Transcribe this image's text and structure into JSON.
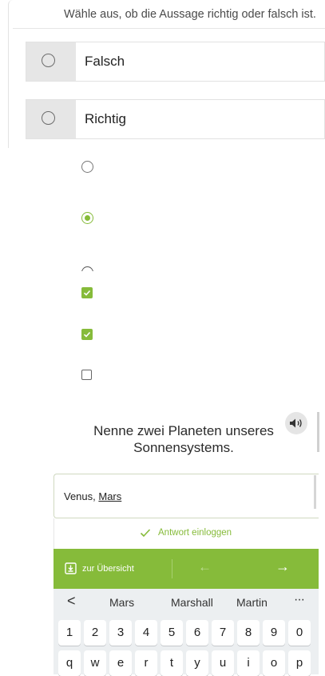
{
  "instruction": "Wähle aus, ob die Aussage richtig oder falsch ist.",
  "options": [
    {
      "label": "Falsch",
      "selected": false
    },
    {
      "label": "Richtig",
      "selected": false
    }
  ],
  "icon_legend": [
    "radio-empty",
    "radio-checked",
    "radio-partial",
    "checkbox-checked",
    "checkbox-checked",
    "checkbox-empty"
  ],
  "question": {
    "text": "Nenne zwei Planeten unseres Sonnensystems.",
    "speaker_icon": "speaker-icon"
  },
  "answer_input": {
    "value_prefix": "Venus, ",
    "value_word": "Mars"
  },
  "submit": {
    "label": "Antwort einloggen"
  },
  "navbar": {
    "overview_label": "zur Übersicht",
    "prev_symbol": "←",
    "next_symbol": "→"
  },
  "keyboard": {
    "back_symbol": "<",
    "suggestions": [
      "Mars",
      "Marshall",
      "Martin"
    ],
    "more_symbol": "···",
    "number_row": [
      "1",
      "2",
      "3",
      "4",
      "5",
      "6",
      "7",
      "8",
      "9",
      "0"
    ],
    "letter_row": [
      "q",
      "w",
      "e",
      "r",
      "t",
      "y",
      "u",
      "i",
      "o",
      "p"
    ]
  },
  "colors": {
    "accent": "#86bb3a",
    "option_radio_bg": "#e6e6e6",
    "keyboard_bg": "#eceff1"
  }
}
